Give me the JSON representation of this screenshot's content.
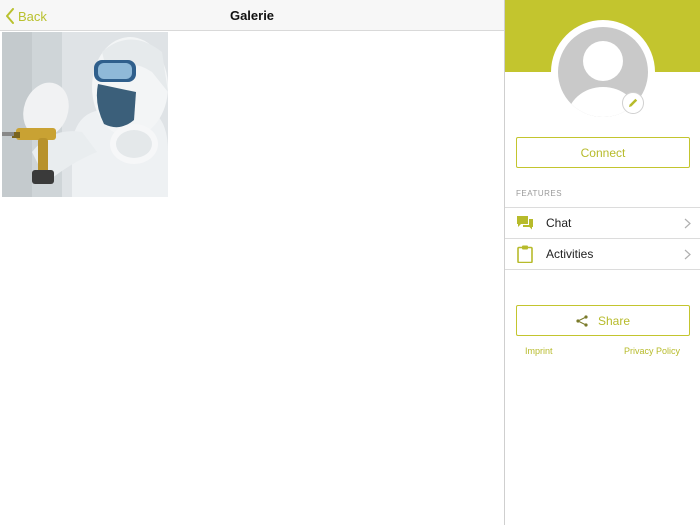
{
  "navbar": {
    "back_label": "Back",
    "title": "Galerie"
  },
  "gallery": {
    "items": [
      {
        "icon": "photo-painter-in-protective-suit"
      }
    ]
  },
  "sidebar": {
    "connect_label": "Connect",
    "features_heading": "FEATURES",
    "features": [
      {
        "label": "Chat",
        "icon": "chat-bubbles-icon"
      },
      {
        "label": "Activities",
        "icon": "clipboard-icon"
      }
    ],
    "share_label": "Share",
    "imprint_label": "Imprint",
    "privacy_label": "Privacy Policy"
  },
  "colors": {
    "accent": "#c3c52e",
    "accent_text": "#b7bb2b",
    "navbar_bg": "#f7f7f7",
    "avatar_bg": "#c9c9c9"
  }
}
